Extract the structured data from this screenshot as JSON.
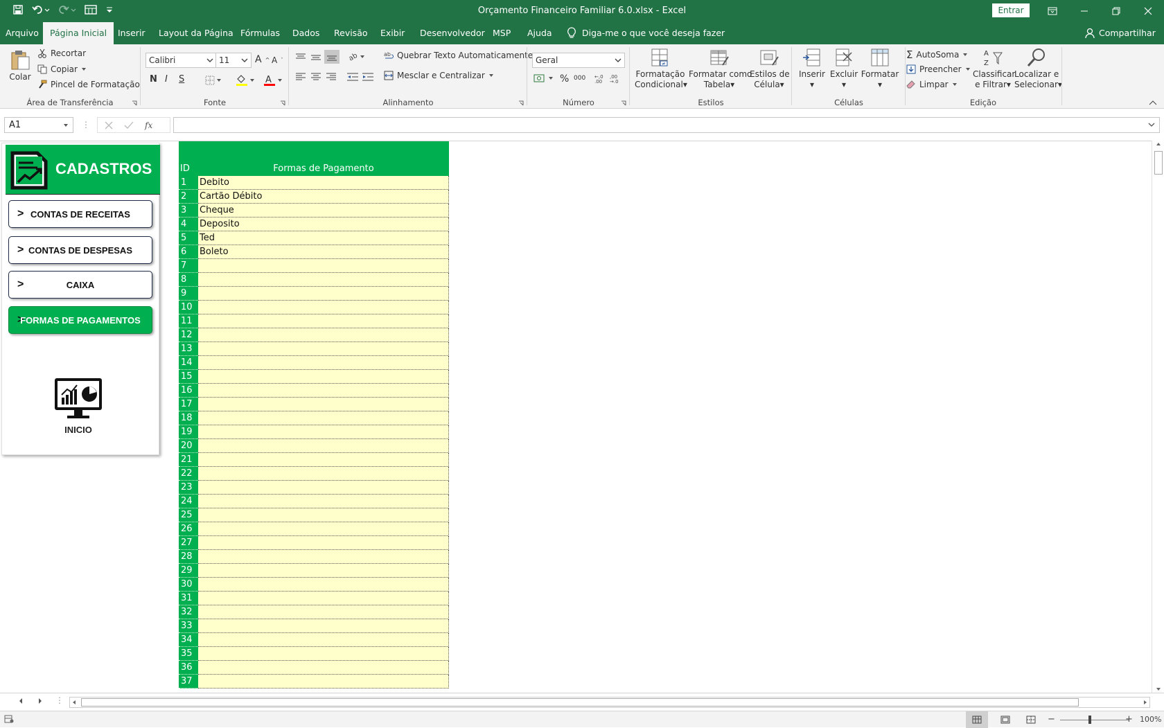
{
  "window": {
    "title": "Orçamento Financeiro Familiar 6.0.xlsx  -  Excel",
    "signin_label": "Entrar"
  },
  "menu": {
    "tabs": [
      "Arquivo",
      "Página Inicial",
      "Inserir",
      "Layout da Página",
      "Fórmulas",
      "Dados",
      "Revisão",
      "Exibir",
      "Desenvolvedor",
      "MSP",
      "Ajuda"
    ],
    "active_tab": "Página Inicial",
    "tell_me": "Diga-me o que você deseja fazer",
    "share": "Compartilhar"
  },
  "ribbon": {
    "clipboard": {
      "paste": "Colar",
      "cut": "Recortar",
      "copy": "Copiar",
      "format_painter": "Pincel de Formatação",
      "label": "Área de Transferência"
    },
    "font": {
      "name": "Calibri",
      "size": "11",
      "bold": "N",
      "italic": "I",
      "underline": "S",
      "label": "Fonte"
    },
    "alignment": {
      "wrap": "Quebrar Texto Automaticamente",
      "merge": "Mesclar e Centralizar",
      "label": "Alinhamento"
    },
    "number": {
      "format": "Geral",
      "label": "Número"
    },
    "styles": {
      "conditional_1": "Formatação",
      "conditional_2": "Condicional",
      "table_1": "Formatar como",
      "table_2": "Tabela",
      "cell_1": "Estilos de",
      "cell_2": "Célula",
      "label": "Estilos"
    },
    "cells": {
      "insert": "Inserir",
      "delete": "Excluir",
      "format": "Formatar",
      "label": "Células"
    },
    "editing": {
      "autosum": "AutoSoma",
      "fill": "Preencher",
      "clear": "Limpar",
      "sort_1": "Classificar",
      "sort_2": "e Filtrar",
      "find_1": "Localizar e",
      "find_2": "Selecionar",
      "label": "Edição"
    }
  },
  "formula_bar": {
    "name_box": "A1",
    "formula": ""
  },
  "panel": {
    "title": "CADASTROS",
    "buttons": [
      "CONTAS DE RECEITAS",
      "CONTAS DE DESPESAS",
      "CAIXA",
      "FORMAS DE PAGAMENTOS"
    ],
    "arrow": ">",
    "inicio": "INICIO"
  },
  "table": {
    "headers": {
      "id": "ID",
      "name": "Formas de Pagamento"
    },
    "rows": [
      {
        "id": "1",
        "name": "Debito"
      },
      {
        "id": "2",
        "name": "Cartão Débito"
      },
      {
        "id": "3",
        "name": "Cheque"
      },
      {
        "id": "4",
        "name": "Deposito"
      },
      {
        "id": "5",
        "name": "Ted"
      },
      {
        "id": "6",
        "name": "Boleto"
      },
      {
        "id": "7",
        "name": ""
      },
      {
        "id": "8",
        "name": ""
      },
      {
        "id": "9",
        "name": ""
      },
      {
        "id": "10",
        "name": ""
      },
      {
        "id": "11",
        "name": ""
      },
      {
        "id": "12",
        "name": ""
      },
      {
        "id": "13",
        "name": ""
      },
      {
        "id": "14",
        "name": ""
      },
      {
        "id": "15",
        "name": ""
      },
      {
        "id": "16",
        "name": ""
      },
      {
        "id": "17",
        "name": ""
      },
      {
        "id": "18",
        "name": ""
      },
      {
        "id": "19",
        "name": ""
      },
      {
        "id": "20",
        "name": ""
      },
      {
        "id": "21",
        "name": ""
      },
      {
        "id": "22",
        "name": ""
      },
      {
        "id": "23",
        "name": ""
      },
      {
        "id": "24",
        "name": ""
      },
      {
        "id": "25",
        "name": ""
      },
      {
        "id": "26",
        "name": ""
      },
      {
        "id": "27",
        "name": ""
      },
      {
        "id": "28",
        "name": ""
      },
      {
        "id": "29",
        "name": ""
      },
      {
        "id": "30",
        "name": ""
      },
      {
        "id": "31",
        "name": ""
      },
      {
        "id": "32",
        "name": ""
      },
      {
        "id": "33",
        "name": ""
      },
      {
        "id": "34",
        "name": ""
      },
      {
        "id": "35",
        "name": ""
      },
      {
        "id": "36",
        "name": ""
      },
      {
        "id": "37",
        "name": ""
      }
    ]
  },
  "status_bar": {
    "zoom": "100%"
  },
  "colors": {
    "excel_green": "#217346",
    "header_green": "#00b050",
    "cell_yellow": "#ffffcc"
  }
}
